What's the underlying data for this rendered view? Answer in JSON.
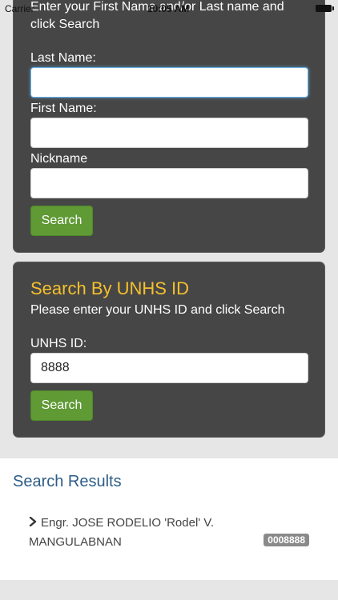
{
  "status_bar": {
    "carrier": "Carrier",
    "time": "10:05 AM"
  },
  "name_search": {
    "intro": "Enter your First Name and/or Last name and click Search",
    "last_name": {
      "label": "Last Name:",
      "value": ""
    },
    "first_name": {
      "label": "First Name:",
      "value": ""
    },
    "nickname": {
      "label": "Nickname",
      "value": ""
    },
    "search_label": "Search"
  },
  "id_search": {
    "title": "Search By UNHS ID",
    "subtitle": "Please enter your UNHS ID and click Search",
    "id_field": {
      "label": "UNHS ID:",
      "value": "8888"
    },
    "search_label": "Search"
  },
  "results": {
    "title": "Search Results",
    "items": [
      {
        "name": "Engr. JOSE RODELIO 'Rodel' V. MANGULABNAN",
        "id": "0008888",
        "icon": "chevron-right-icon"
      }
    ]
  },
  "colors": {
    "panel_bg": "#464646",
    "title_yellow": "#f5c02c",
    "button_green": "#5f9a35",
    "results_title_blue": "#2e5d87",
    "badge_gray": "#8a8a8a"
  }
}
